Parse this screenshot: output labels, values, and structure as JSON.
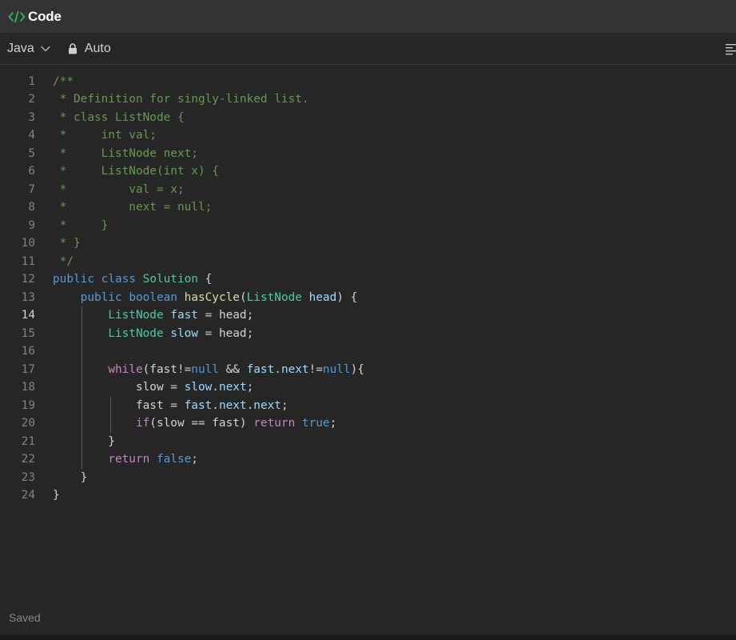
{
  "panel": {
    "title": "Code",
    "icon": "code-icon",
    "accent_color": "#2cbb5d"
  },
  "toolbar": {
    "language": "Java",
    "language_icon": "chevron-down-icon",
    "mode": "Auto",
    "mode_icon": "lock-icon",
    "format_icon": "format-align-icon"
  },
  "editor": {
    "active_line": 14,
    "lines": [
      {
        "n": "1",
        "tokens": [
          {
            "t": "/**",
            "c": "comment"
          }
        ]
      },
      {
        "n": "2",
        "tokens": [
          {
            "t": " * Definition for singly-linked list.",
            "c": "comment"
          }
        ]
      },
      {
        "n": "3",
        "tokens": [
          {
            "t": " * class ListNode {",
            "c": "comment"
          }
        ]
      },
      {
        "n": "4",
        "tokens": [
          {
            "t": " *     int val;",
            "c": "comment"
          }
        ]
      },
      {
        "n": "5",
        "tokens": [
          {
            "t": " *     ListNode next;",
            "c": "comment"
          }
        ]
      },
      {
        "n": "6",
        "tokens": [
          {
            "t": " *     ListNode(int x) {",
            "c": "comment"
          }
        ]
      },
      {
        "n": "7",
        "tokens": [
          {
            "t": " *         val = x;",
            "c": "comment"
          }
        ]
      },
      {
        "n": "8",
        "tokens": [
          {
            "t": " *         next = null;",
            "c": "comment"
          }
        ]
      },
      {
        "n": "9",
        "tokens": [
          {
            "t": " *     }",
            "c": "comment"
          }
        ]
      },
      {
        "n": "10",
        "tokens": [
          {
            "t": " * }",
            "c": "comment"
          }
        ]
      },
      {
        "n": "11",
        "tokens": [
          {
            "t": " */",
            "c": "comment"
          }
        ]
      },
      {
        "n": "12",
        "tokens": [
          {
            "t": "public",
            "c": "keyword"
          },
          {
            "t": " ",
            "c": "plain"
          },
          {
            "t": "class",
            "c": "keyword"
          },
          {
            "t": " ",
            "c": "plain"
          },
          {
            "t": "Solution",
            "c": "type"
          },
          {
            "t": " {",
            "c": "plain"
          }
        ]
      },
      {
        "n": "13",
        "tokens": [
          {
            "t": "    ",
            "c": "plain"
          },
          {
            "t": "public",
            "c": "keyword"
          },
          {
            "t": " ",
            "c": "plain"
          },
          {
            "t": "boolean",
            "c": "keyword"
          },
          {
            "t": " ",
            "c": "plain"
          },
          {
            "t": "hasCycle",
            "c": "func"
          },
          {
            "t": "(",
            "c": "plain"
          },
          {
            "t": "ListNode",
            "c": "type"
          },
          {
            "t": " ",
            "c": "plain"
          },
          {
            "t": "head",
            "c": "var"
          },
          {
            "t": ") {",
            "c": "plain"
          }
        ]
      },
      {
        "n": "14",
        "tokens": [
          {
            "t": "        ",
            "c": "plain"
          },
          {
            "t": "ListNode",
            "c": "type"
          },
          {
            "t": " ",
            "c": "plain"
          },
          {
            "t": "fast",
            "c": "var"
          },
          {
            "t": " = head;",
            "c": "plain"
          }
        ]
      },
      {
        "n": "15",
        "tokens": [
          {
            "t": "        ",
            "c": "plain"
          },
          {
            "t": "ListNode",
            "c": "type"
          },
          {
            "t": " ",
            "c": "plain"
          },
          {
            "t": "slow",
            "c": "var"
          },
          {
            "t": " = head;",
            "c": "plain"
          }
        ]
      },
      {
        "n": "16",
        "tokens": [
          {
            "t": "",
            "c": "plain"
          }
        ]
      },
      {
        "n": "17",
        "tokens": [
          {
            "t": "        ",
            "c": "plain"
          },
          {
            "t": "while",
            "c": "control"
          },
          {
            "t": "(fast!=",
            "c": "plain"
          },
          {
            "t": "null",
            "c": "keyword"
          },
          {
            "t": " && ",
            "c": "plain"
          },
          {
            "t": "fast",
            "c": "var"
          },
          {
            "t": ".",
            "c": "plain"
          },
          {
            "t": "next",
            "c": "var"
          },
          {
            "t": "!=",
            "c": "plain"
          },
          {
            "t": "null",
            "c": "keyword"
          },
          {
            "t": "){",
            "c": "plain"
          }
        ]
      },
      {
        "n": "18",
        "tokens": [
          {
            "t": "            slow = ",
            "c": "plain"
          },
          {
            "t": "slow",
            "c": "var"
          },
          {
            "t": ".",
            "c": "plain"
          },
          {
            "t": "next",
            "c": "var"
          },
          {
            "t": ";",
            "c": "plain"
          }
        ]
      },
      {
        "n": "19",
        "tokens": [
          {
            "t": "            fast = ",
            "c": "plain"
          },
          {
            "t": "fast",
            "c": "var"
          },
          {
            "t": ".",
            "c": "plain"
          },
          {
            "t": "next",
            "c": "var"
          },
          {
            "t": ".",
            "c": "plain"
          },
          {
            "t": "next",
            "c": "var"
          },
          {
            "t": ";",
            "c": "plain"
          }
        ]
      },
      {
        "n": "20",
        "tokens": [
          {
            "t": "            ",
            "c": "plain"
          },
          {
            "t": "if",
            "c": "control"
          },
          {
            "t": "(slow == fast) ",
            "c": "plain"
          },
          {
            "t": "return",
            "c": "control"
          },
          {
            "t": " ",
            "c": "plain"
          },
          {
            "t": "true",
            "c": "keyword"
          },
          {
            "t": ";",
            "c": "plain"
          }
        ]
      },
      {
        "n": "21",
        "tokens": [
          {
            "t": "        }",
            "c": "plain"
          }
        ]
      },
      {
        "n": "22",
        "tokens": [
          {
            "t": "        ",
            "c": "plain"
          },
          {
            "t": "return",
            "c": "control"
          },
          {
            "t": " ",
            "c": "plain"
          },
          {
            "t": "false",
            "c": "keyword"
          },
          {
            "t": ";",
            "c": "plain"
          }
        ]
      },
      {
        "n": "23",
        "tokens": [
          {
            "t": "    }",
            "c": "plain"
          }
        ]
      },
      {
        "n": "24",
        "tokens": [
          {
            "t": "}",
            "c": "plain"
          }
        ]
      }
    ]
  },
  "status": {
    "text": "Saved"
  }
}
